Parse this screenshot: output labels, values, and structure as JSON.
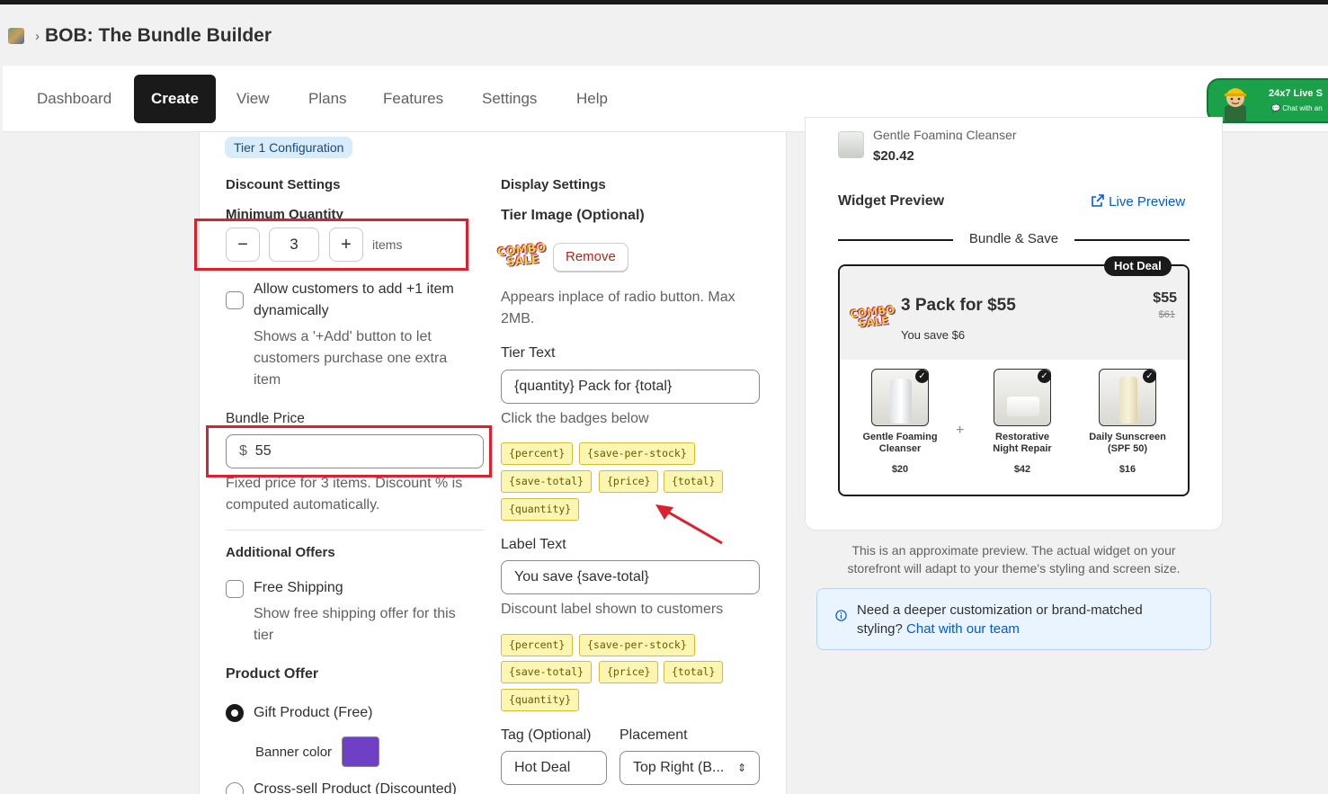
{
  "header": {
    "breadcrumb_sep": "›",
    "app_title": "BOB: The Bundle Builder"
  },
  "nav": {
    "items": [
      "Dashboard",
      "Create",
      "View",
      "Plans",
      "Features",
      "Settings",
      "Help"
    ],
    "active": "Create"
  },
  "support": {
    "title": "24x7 Live S",
    "subtitle": "Chat with an"
  },
  "tier": {
    "badge": "Tier 1 Configuration",
    "discount": {
      "heading": "Discount Settings",
      "min_qty_label": "Minimum Quantity",
      "minus": "−",
      "qty": "3",
      "plus": "+",
      "unit": "items",
      "allow_label_1": "Allow customers to add +1 item",
      "allow_label_2": "dynamically",
      "allow_help_1": "Shows a '+Add' button to let",
      "allow_help_2": "customers purchase one extra",
      "allow_help_3": "item",
      "bundle_price_label": "Bundle Price",
      "currency": "$",
      "bundle_price": "55",
      "bundle_help_1": "Fixed price for 3 items. Discount % is",
      "bundle_help_2": "computed automatically."
    },
    "offers": {
      "heading": "Additional Offers",
      "free_shipping_label": "Free Shipping",
      "free_shipping_help_1": "Show free shipping offer for this",
      "free_shipping_help_2": "tier"
    },
    "product_offer": {
      "heading": "Product Offer",
      "gift_label": "Gift Product (Free)",
      "banner_color_label": "Banner color",
      "banner_color": "#6f3fc6",
      "crosssell_label": "Cross-sell Product (Discounted)"
    },
    "display": {
      "heading": "Display Settings",
      "image_label": "Tier Image (Optional)",
      "image_text_1": "COMBO",
      "image_text_2": "SALE",
      "remove_label": "Remove",
      "image_help_1": "Appears inplace of radio button. Max",
      "image_help_2": "2MB.",
      "tier_text_label": "Tier Text",
      "tier_text_value": "{quantity} Pack for {total}",
      "badges_help": "Click the badges below",
      "tokens": [
        "{percent}",
        "{save-per-stock}",
        "{save-total}",
        "{price}",
        "{total}",
        "{quantity}"
      ],
      "label_text_label": "Label Text",
      "label_text_value": "You save {save-total}",
      "label_help": "Discount label shown to customers",
      "tag_label": "Tag (Optional)",
      "tag_value": "Hot Deal",
      "placement_label": "Placement",
      "placement_value": "Top Right (B...",
      "select_icon": "⌃⌄"
    }
  },
  "preview": {
    "top_product_name": "Gentle Foaming Cleanser",
    "top_product_price": "$20.42",
    "heading": "Widget Preview",
    "live_preview_label": "Live Preview",
    "divider_text": "Bundle & Save",
    "tag": "Hot Deal",
    "tier_title": "3 Pack for $55",
    "tier_save": "You save $6",
    "price": "$55",
    "compare_price": "$61",
    "plus_sign": "+",
    "products": [
      {
        "name_1": "Gentle Foaming",
        "name_2": "Cleanser",
        "price": "$20"
      },
      {
        "name_1": "Restorative",
        "name_2": "Night Repair",
        "price": "$42"
      },
      {
        "name_1": "Daily Sunscreen",
        "name_2": "(SPF 50)",
        "price": "$16"
      }
    ],
    "note_1": "This is an approximate preview. The actual widget on your",
    "note_2": "storefront will adapt to your theme's styling and screen size.",
    "info_1": "Need a deeper customization or brand-matched",
    "info_2": "styling?",
    "info_link": "Chat with our team"
  },
  "colors": {
    "accent_red": "#d8222d",
    "link": "#005bd3",
    "token_bg": "#fdf6b2"
  }
}
